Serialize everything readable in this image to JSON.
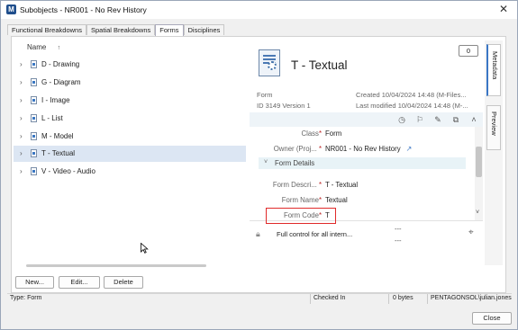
{
  "window": {
    "title": "Subobjects - NR001 - No Rev History",
    "app_icon_letter": "M",
    "close_glyph": "✕"
  },
  "tabs": [
    {
      "label": "Functional Breakdowns"
    },
    {
      "label": "Spatial Breakdowns"
    },
    {
      "label": "Forms"
    },
    {
      "label": "Disciplines"
    }
  ],
  "tree": {
    "column_header": "Name",
    "sort_glyph": "↑",
    "items": [
      {
        "label": "D - Drawing"
      },
      {
        "label": "G - Diagram"
      },
      {
        "label": "I - Image"
      },
      {
        "label": "L - List"
      },
      {
        "label": "M - Model"
      },
      {
        "label": "T - Textual"
      },
      {
        "label": "V - Video - Audio"
      }
    ],
    "selected_index": 5
  },
  "buttons": {
    "new": "New...",
    "edit": "Edit...",
    "delete": "Delete",
    "close": "Close"
  },
  "metadata": {
    "object_title": "T - Textual",
    "comment_count": "0",
    "class_name": "Form",
    "id_version": "ID 3149  Version 1",
    "created": "Created 10/04/2024 14:48 (M-Files...",
    "modified": "Last modified 10/04/2024 14:48 (M-...",
    "properties": {
      "class_label": "Class",
      "class_value": "Form",
      "owner_label": "Owner (Proj...",
      "owner_value": "NR001 - No Rev History",
      "group_label": "Form Details",
      "desc_label": "Form Descri...",
      "desc_value": "T - Textual",
      "name_label": "Form Name",
      "name_value": "Textual",
      "code_label": "Form Code",
      "code_value": "T",
      "required_mark": "*"
    },
    "permission": "Full control for all intern...",
    "perm_dash_1": "---",
    "perm_dash_2": "---"
  },
  "side_tabs": {
    "metadata": "Metadata",
    "preview": "Preview"
  },
  "status": {
    "type": "Type: Form",
    "state": "Checked In",
    "size": "0 bytes",
    "user": "PENTAGONSOL\\julian.jones"
  },
  "colors": {
    "selection": "#dce6f3",
    "highlight_box": "#e02a2a",
    "accent": "#3a76c4"
  }
}
